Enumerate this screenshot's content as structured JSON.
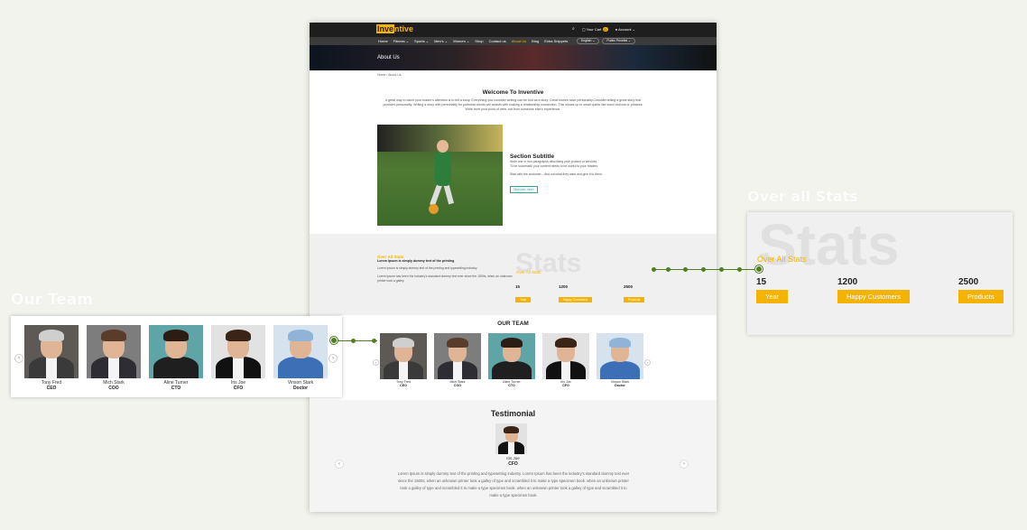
{
  "callouts": {
    "team_label": "Our Team",
    "stats_label": "Over all Stats"
  },
  "header": {
    "logo_highlight": "Inve",
    "logo_rest": "ntive",
    "cart_label": "Your Cart",
    "cart_count": "0",
    "account_label": "Account"
  },
  "nav": {
    "items": [
      "Home",
      "Fitness ⌄",
      "Sports ⌄",
      "Men's ⌄",
      "Women ⌄",
      "Shop",
      "Contact us",
      "About Us",
      "Blog",
      "Extra Snippets"
    ],
    "active_index": 7,
    "language": "English ⌄",
    "pricelist": "Public Pricelist ⌄"
  },
  "hero": {
    "title": "About Us"
  },
  "breadcrumb": {
    "home": "Home",
    "sep": "/",
    "current": "About Us"
  },
  "welcome": {
    "title": "Welcome To Inventive",
    "body": "A great way to catch your reader's attention is to tell a story. Everything you consider writing can be told as a story. Great stories have personality.Consider telling a great story that provides personality. Writing a story with personality for potential clients will assists with making a relationship connection. This shows up in small quirks like word choices or phrases. Write from your point of view, not from someone else's experience."
  },
  "feature": {
    "title": "Section Subtitle",
    "p1": "Write one or two paragraphs describing your product or services.",
    "p2": "To be successful your content needs to be useful to your readers.",
    "p3": "Start with the customer – find out what they want and give it to them.",
    "button": "Discover more"
  },
  "stats": {
    "eyebrow": "Over All Stats",
    "strong": "Lorem Ipsum is simply dummy text of the printing",
    "p1": "Lorem Ipsum is simply dummy text of the printing and typesetting industry.",
    "p2": "Lorem Ipsum has been the industry's standard dummy text ever since the 1500s, when an unknown printer took a galley.",
    "watermark": "Stats",
    "title": "Over All Stats",
    "items": [
      {
        "value": "15",
        "label": "Year"
      },
      {
        "value": "1200",
        "label": "Happy Customers"
      },
      {
        "value": "2500",
        "label": "Products"
      }
    ]
  },
  "team": {
    "title": "OUR TEAM",
    "members": [
      {
        "name": "Tony Fred",
        "role": "CEO"
      },
      {
        "name": "Mich Stark",
        "role": "COO"
      },
      {
        "name": "Aline Turner",
        "role": "CTO"
      },
      {
        "name": "Iris Joe",
        "role": "CFO"
      },
      {
        "name": "Vinson Stark",
        "role": "Doctor"
      }
    ]
  },
  "testimonial": {
    "title": "Testimonial",
    "name": "Iris Joe",
    "role": "CFO",
    "text": "Lorem Ipsum is simply dummy text of the printing and typesetting industry. Lorem Ipsum has been the industry's standard dummy text ever since the 1500s, when an unknown printer took a galley of type and scrambled it to make a type specimen book. when an unknown printer took a galley of type and scrambled it to make a type specimen book. when an unknown printer took a galley of type and scrambled it to make a type specimen book."
  },
  "icons": {
    "prev": "‹",
    "next": "›",
    "search": "⌕",
    "cart": "🛍",
    "user": "👤"
  },
  "colors": {
    "accent": "#f5b301",
    "connector": "#4f7f1f",
    "teal": "#2aa5a0"
  }
}
